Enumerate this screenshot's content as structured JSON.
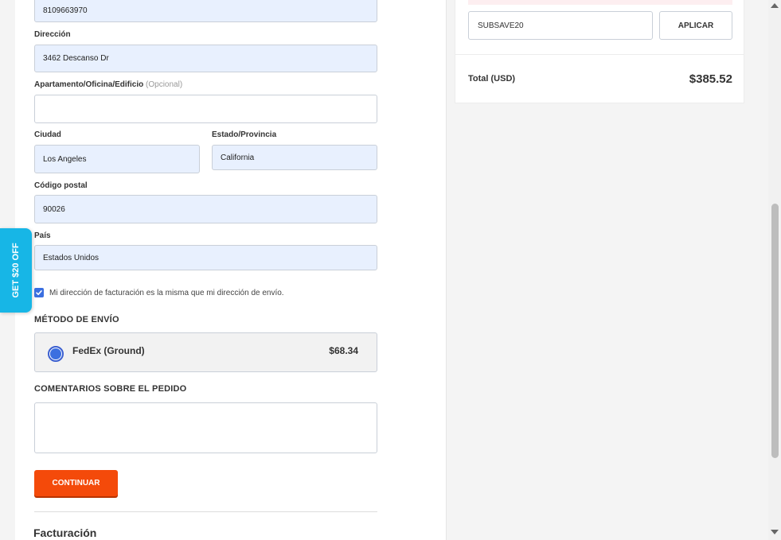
{
  "form": {
    "phone_value": "8109663970",
    "address_label": "Dirección",
    "address_value": "3462 Descanso Dr",
    "apt_label": "Apartamento/Oficina/Edificio",
    "apt_optional": "(Opcional)",
    "apt_value": "",
    "city_label": "Ciudad",
    "city_value": "Los Angeles",
    "state_label": "Estado/Provincia",
    "state_value": "California",
    "zip_label": "Código postal",
    "zip_value": "90026",
    "country_label": "País",
    "country_value": "Estados Unidos",
    "billing_same_checked": true,
    "billing_same_label": "Mi dirección de facturación es la misma que mi dirección de envío."
  },
  "shipping": {
    "section_title": "MÉTODO DE ENVÍO",
    "method_name": "FedEx (Ground)",
    "method_price": "$68.34",
    "selected": true
  },
  "comments": {
    "section_title": "COMENTARIOS SOBRE EL PEDIDO",
    "value": ""
  },
  "actions": {
    "continue_label": "CONTINUAR"
  },
  "billing": {
    "title": "Facturación"
  },
  "promo_tab": {
    "label": "GET $20 OFF"
  },
  "summary": {
    "coupon_value": "SUBSAVE20",
    "apply_label": "APLICAR",
    "total_label": "Total (USD)",
    "total_value": "$385.52"
  },
  "colors": {
    "accent_orange": "#f44a0a",
    "promo_blue": "#17b6e6",
    "field_fill": "#e8f0fe",
    "checkbox_blue": "#3b6fe0"
  }
}
